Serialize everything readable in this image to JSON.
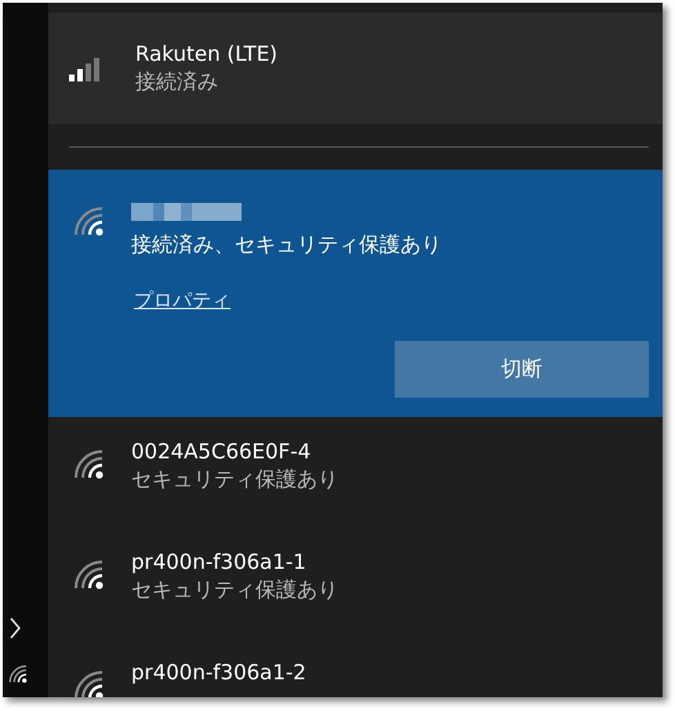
{
  "cellular": {
    "name": "Rakuten (LTE)",
    "status": "接続済み"
  },
  "connected": {
    "name_hidden": true,
    "status": "接続済み、セキュリティ保護あり",
    "link": "プロパティ",
    "button": "切断"
  },
  "networks": [
    {
      "name": "0024A5C66E0F-4",
      "status": "セキュリティ保護あり"
    },
    {
      "name": "pr400n-f306a1-1",
      "status": "セキュリティ保護あり"
    },
    {
      "name": "pr400n-f306a1-2"
    }
  ]
}
